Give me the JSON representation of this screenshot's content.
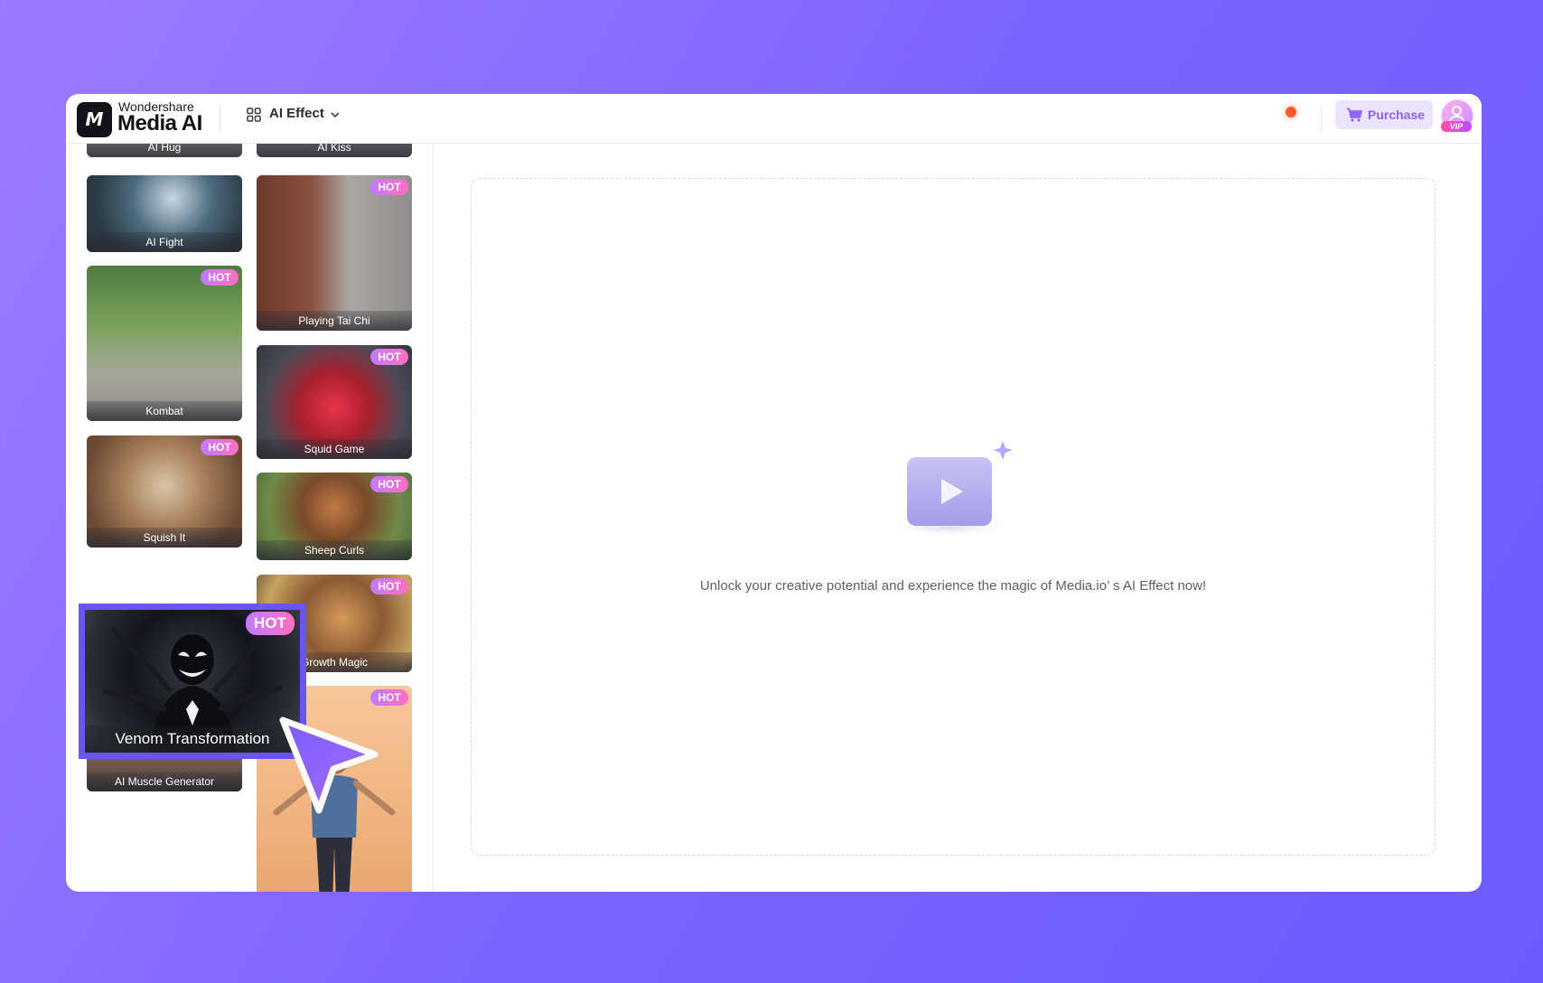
{
  "header": {
    "brand_sub": "Wondershare",
    "brand_main": "Media AI",
    "logo_mark": "M",
    "menu_label": "AI Effect",
    "purchase_label": "Purchase",
    "vip_label": "VIP"
  },
  "sidebar": {
    "cards": [
      {
        "label": "AI Hug",
        "hot": false
      },
      {
        "label": "AI Kiss",
        "hot": false
      },
      {
        "label": "AI Fight",
        "hot": false
      },
      {
        "label": "Playing Tai Chi",
        "hot": true
      },
      {
        "label": "Kombat",
        "hot": true
      },
      {
        "label": "Squid Game",
        "hot": true
      },
      {
        "label": "Squish It",
        "hot": true
      },
      {
        "label": "Sheep Curls",
        "hot": true
      },
      {
        "label": "Venom Transformation",
        "hot": true
      },
      {
        "label": "Growth Magic",
        "hot": true
      },
      {
        "label": "AI Muscle Generator",
        "hot": false
      },
      {
        "label": "",
        "hot": true
      }
    ],
    "hot_text": "HOT"
  },
  "main": {
    "empty_message": "Unlock your creative potential and experience the magic of Media.io’ s AI Effect now!"
  },
  "colors": {
    "accent": "#6a55f2",
    "purchase_bg": "#ece4ff",
    "purchase_text": "#8a63ff",
    "notification": "#ff5a2a"
  },
  "icons": [
    "grid-icon",
    "chevron-down-icon",
    "cart-icon",
    "avatar-icon",
    "video-play-icon",
    "sparkle-icon",
    "cursor-arrow-icon"
  ]
}
